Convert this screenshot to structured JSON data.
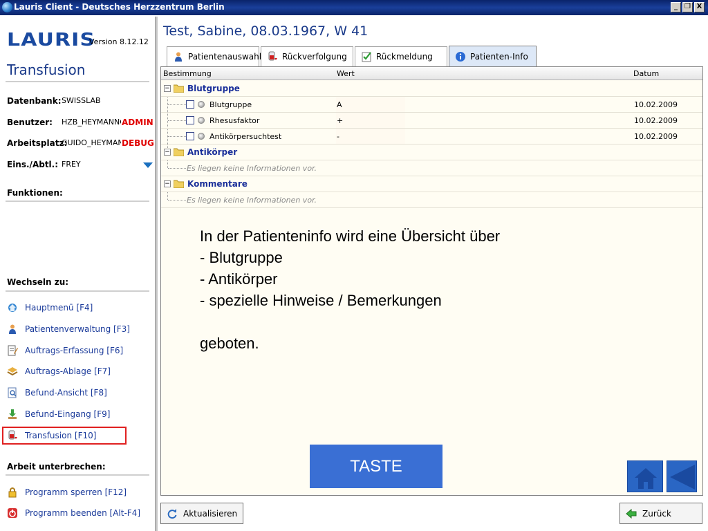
{
  "window": {
    "title": "Lauris Client - Deutsches Herzzentrum Berlin",
    "minimize_glyph": "_",
    "restore_glyph": "❐",
    "close_glyph": "X"
  },
  "sidebar": {
    "logo_text": "LAURIS",
    "version": "Version 8.12.12",
    "module_title": "Transfusion",
    "info": [
      {
        "key": "Datenbank:",
        "value": "SWISSLAB",
        "flag": ""
      },
      {
        "key": "Benutzer:",
        "value": "HZB_HEYMANNG",
        "flag": "ADMIN"
      },
      {
        "key": "Arbeitsplatz:",
        "value": "GUIDO_HEYMAN",
        "flag": "DEBUG"
      },
      {
        "key": "Eins./Abtl.:",
        "value": "FREY",
        "flag": ""
      }
    ],
    "functions_heading": "Funktionen:",
    "switch_heading": "Wechseln zu:",
    "switch_items": [
      {
        "label": "Hauptmenü [F4]",
        "icon": "home-globe-icon"
      },
      {
        "label": "Patientenverwaltung [F3]",
        "icon": "person-icon"
      },
      {
        "label": "Auftrags-Erfassung [F6]",
        "icon": "order-entry-icon"
      },
      {
        "label": "Auftrags-Ablage [F7]",
        "icon": "order-archive-icon"
      },
      {
        "label": "Befund-Ansicht [F8]",
        "icon": "report-view-icon"
      },
      {
        "label": "Befund-Eingang [F9]",
        "icon": "report-inbox-icon"
      },
      {
        "label": "Transfusion [F10]",
        "icon": "transfusion-icon"
      }
    ],
    "interrupt_heading": "Arbeit unterbrechen:",
    "interrupt_items": [
      {
        "label": "Programm sperren [F12]",
        "icon": "lock-icon"
      },
      {
        "label": "Programm beenden [Alt-F4]",
        "icon": "power-icon"
      }
    ]
  },
  "main": {
    "patient_header": "Test, Sabine, 08.03.1967, W 41",
    "tabs": [
      {
        "label": "Patientenauswahl",
        "icon": "person-icon",
        "active": false
      },
      {
        "label": "Rückverfolgung",
        "icon": "transfusion-icon",
        "active": false
      },
      {
        "label": "Rückmeldung",
        "icon": "checklist-icon",
        "active": false
      },
      {
        "label": "Patienten-Info",
        "icon": "info-icon",
        "active": true
      }
    ],
    "grid": {
      "columns": [
        "Bestimmung",
        "Wert",
        "Datum"
      ],
      "groups": [
        {
          "label": "Blutgruppe",
          "rows": [
            {
              "name": "Blutgruppe",
              "value": "A",
              "date": "10.02.2009"
            },
            {
              "name": "Rhesusfaktor",
              "value": "+",
              "date": "10.02.2009"
            },
            {
              "name": "Antikörpersuchtest",
              "value": "-",
              "date": "10.02.2009"
            }
          ]
        },
        {
          "label": "Antikörper",
          "empty_text": "Es liegen keine Informationen vor."
        },
        {
          "label": "Kommentare",
          "empty_text": "Es liegen keine Informationen vor."
        }
      ]
    },
    "overlay_lines": [
      "In der Patienteninfo wird eine Übersicht über",
      "- Blutgruppe",
      "- Antikörper",
      "- spezielle Hinweise / Bemerkungen",
      "",
      "geboten."
    ],
    "taste_button": "TASTE",
    "home_button_icon": "home-icon",
    "back_button_icon": "back-triangle-icon"
  },
  "bottom": {
    "refresh_label": "Aktualisieren",
    "back_label": "Zurück"
  },
  "colors": {
    "titlebar": "#0a246a",
    "accent_blue": "#1a3a8a",
    "flag_red": "#e00000",
    "panel_bg": "#fffdf3",
    "taste_bg": "#3a6fd4",
    "nav_square_bg": "#2a66c4"
  }
}
